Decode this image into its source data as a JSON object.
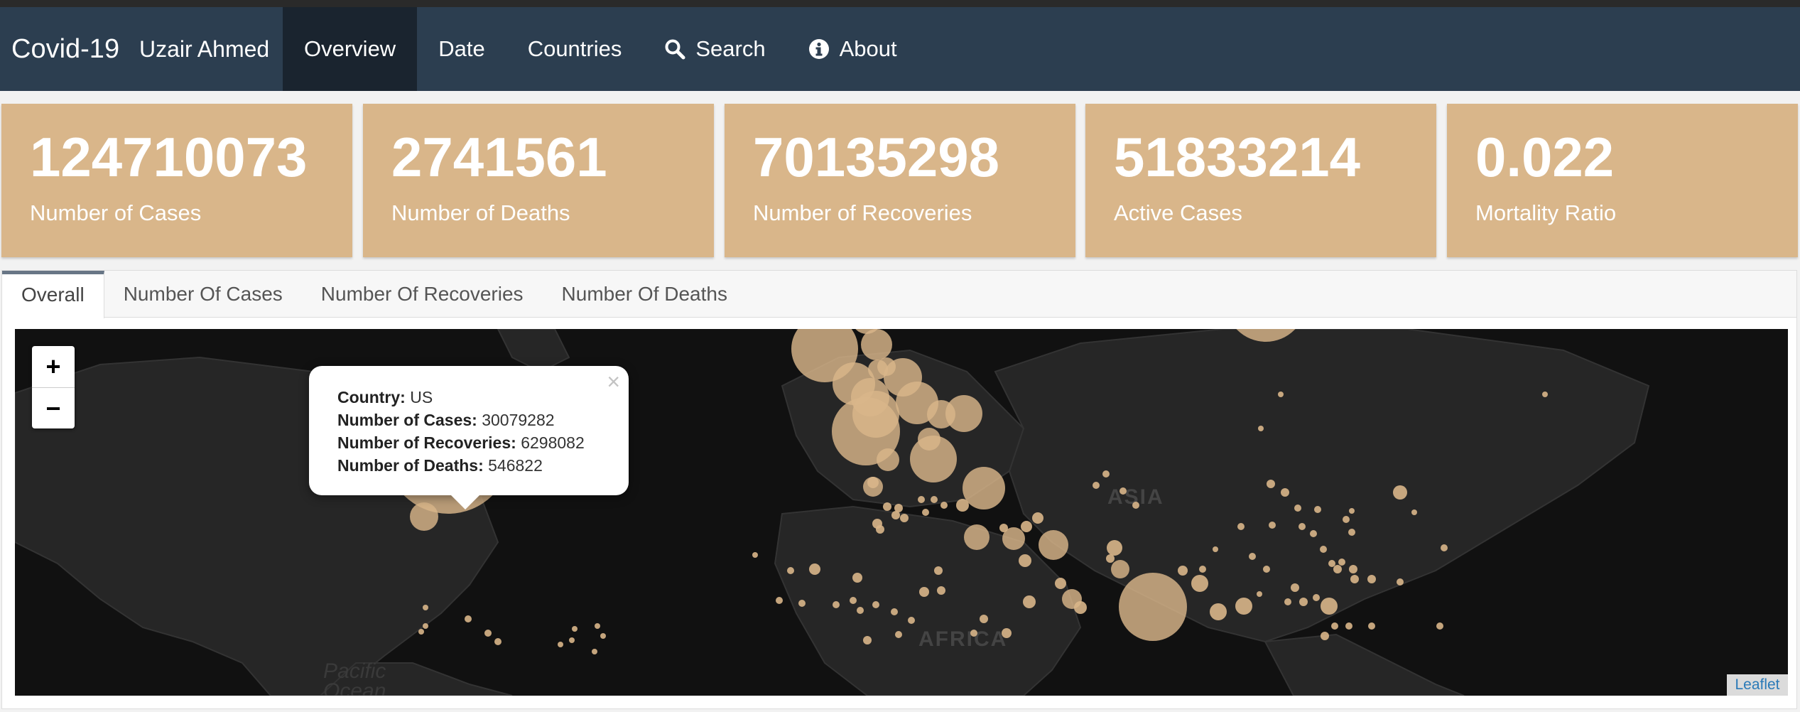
{
  "navbar": {
    "brand": "Covid-19",
    "author": "Uzair Ahmed",
    "items": [
      {
        "label": "Overview",
        "active": true
      },
      {
        "label": "Date"
      },
      {
        "label": "Countries"
      },
      {
        "label": "Search",
        "icon": "search-icon"
      },
      {
        "label": "About",
        "icon": "info-icon"
      }
    ]
  },
  "value_boxes": [
    {
      "value": "124710073",
      "label": "Number of Cases"
    },
    {
      "value": "2741561",
      "label": "Number of Deaths"
    },
    {
      "value": "70135298",
      "label": "Number of Recoveries"
    },
    {
      "value": "51833214",
      "label": "Active Cases"
    },
    {
      "value": "0.022",
      "label": "Mortality Ratio"
    }
  ],
  "tabs": [
    "Overall",
    "Number Of Cases",
    "Number Of Recoveries",
    "Number Of Deaths"
  ],
  "map": {
    "zoom_in": "+",
    "zoom_out": "−",
    "popup": {
      "close": "×",
      "country_label": "Country:",
      "country": "US",
      "cases_label": "Number of Cases:",
      "cases": "30079282",
      "recoveries_label": "Number of Recoveries:",
      "recoveries": "6298082",
      "deaths_label": "Number of Deaths:",
      "deaths": "546822"
    },
    "labels": {
      "asia": "ASIA",
      "africa": "AFRICA",
      "ocean_1": "Pacific",
      "ocean_2": "Ocean"
    },
    "attribution": "Leaflet"
  },
  "colors": {
    "navbar": "#2c3e50",
    "navbar_active": "#1a242f",
    "value_box": "#d9b68a",
    "marker": "#d9b68a",
    "map_background": "#111111"
  }
}
